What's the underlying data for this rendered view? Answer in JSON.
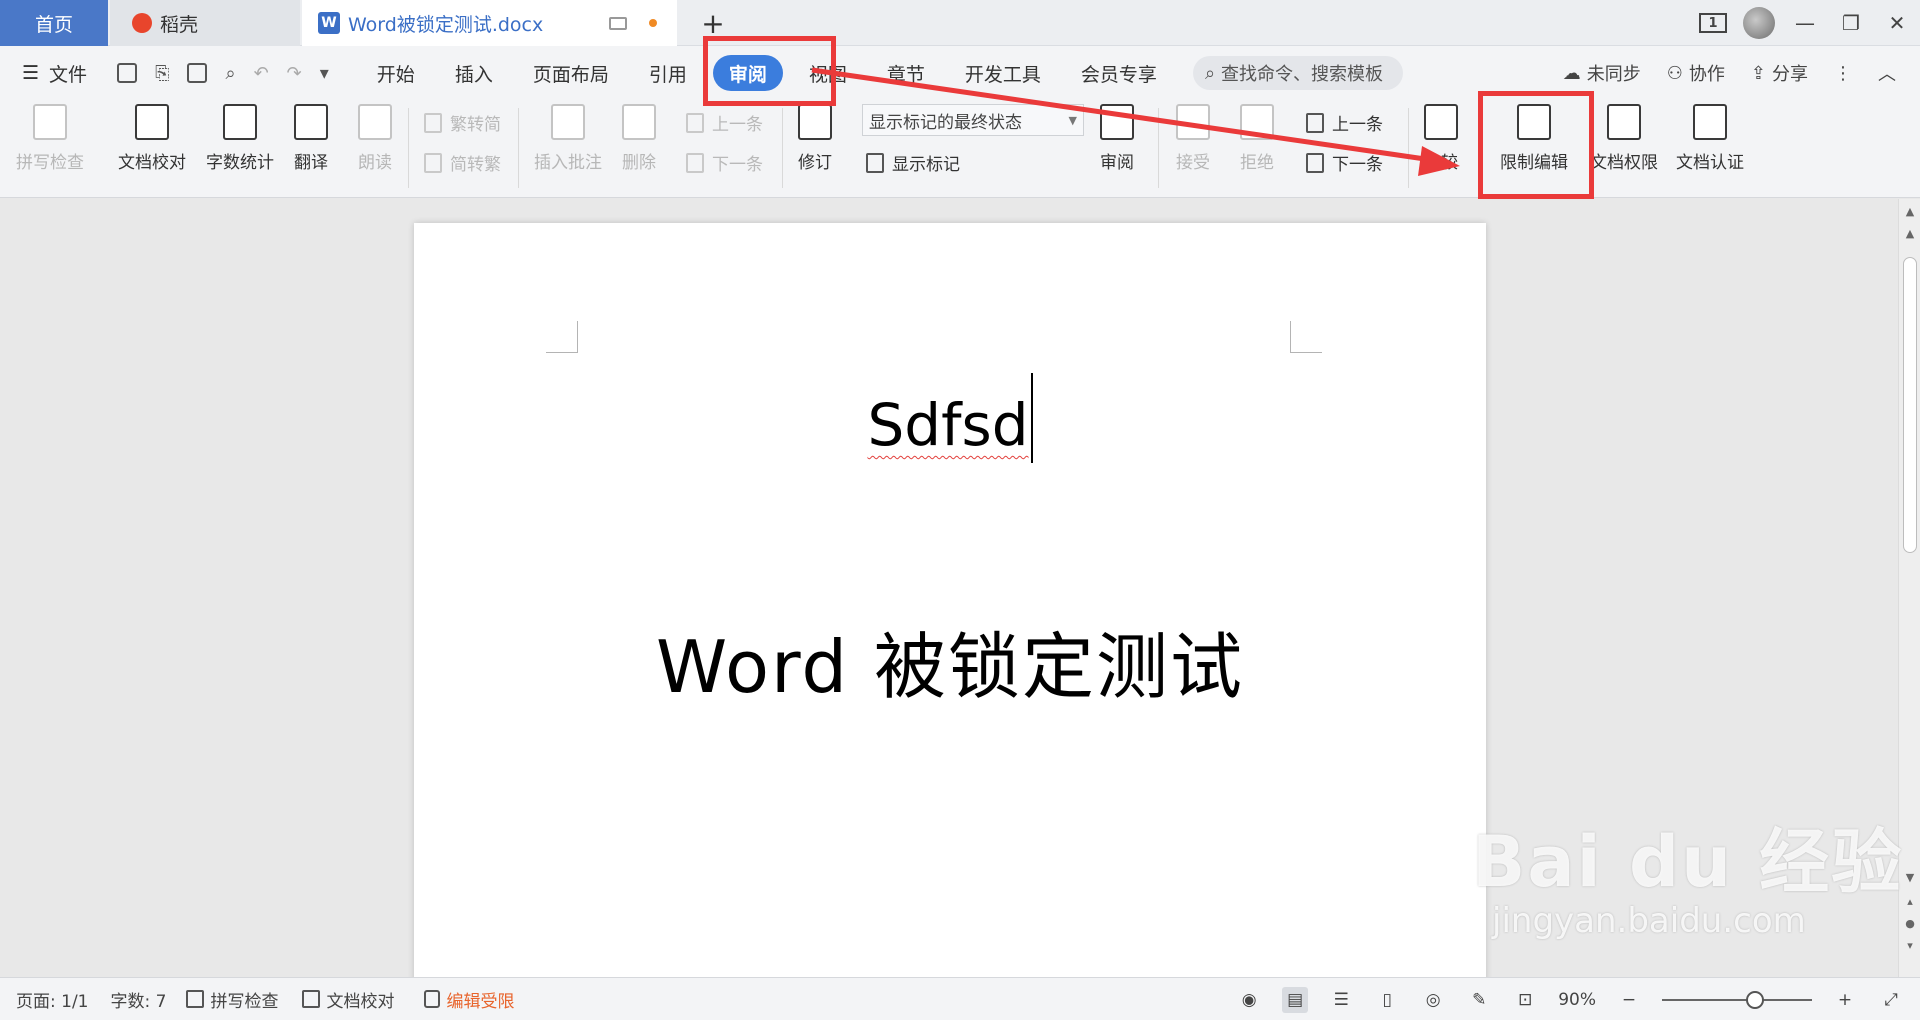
{
  "tabs": {
    "home": "首页",
    "daoke": "稻壳",
    "doc": "Word被锁定测试.docx",
    "add": "+"
  },
  "window": {
    "badge": "1"
  },
  "menu": {
    "file": "文件",
    "tabs": [
      "开始",
      "插入",
      "页面布局",
      "引用",
      "审阅",
      "视图",
      "章节",
      "开发工具",
      "会员专享"
    ],
    "search_placeholder": "查找命令、搜索模板",
    "unsynced": "未同步",
    "collab": "协作",
    "share": "分享"
  },
  "ribbon": {
    "spell": "拼写检查",
    "doc_proof": "文档校对",
    "word_count": "字数统计",
    "translate": "翻译",
    "read": "朗读",
    "trad_to_simp": "繁转简",
    "simp_to_trad": "简转繁",
    "insert_comment": "插入批注",
    "delete": "删除",
    "prev_comment": "上一条",
    "next_comment": "下一条",
    "revise": "修订",
    "markup_select": "显示标记的最终状态",
    "show_markup": "显示标记",
    "review": "审阅",
    "accept": "接受",
    "reject": "拒绝",
    "prev_change": "上一条",
    "next_change": "下一条",
    "compare": "比较",
    "restrict_edit": "限制编辑",
    "doc_rights": "文档权限",
    "doc_auth": "文档认证"
  },
  "document": {
    "line1": "Sdfsd",
    "line2": "Word 被锁定测试"
  },
  "status": {
    "page": "页面: 1/1",
    "words": "字数: 7",
    "spell": "拼写检查",
    "proof": "文档校对",
    "edit_restricted": "编辑受限",
    "zoom": "90%"
  },
  "watermark": {
    "brand": "Bai du 经验",
    "url": "jingyan.baidu.com"
  },
  "colors": {
    "accent": "#3b7ddd",
    "annotation_red": "#ea3a3a",
    "warning_orange": "#e8642c"
  }
}
